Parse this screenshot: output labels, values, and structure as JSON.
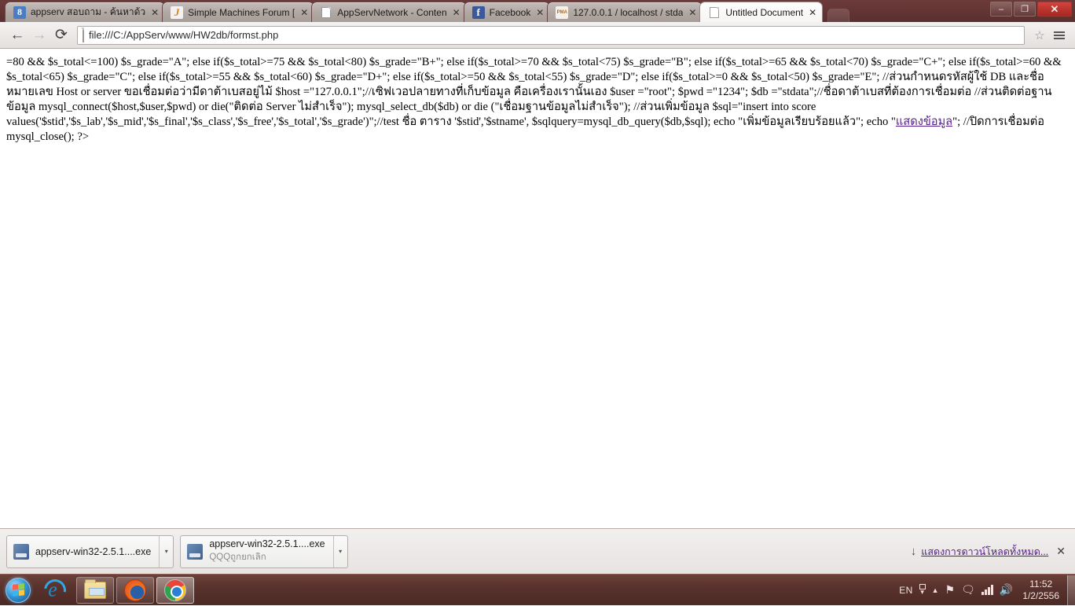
{
  "window": {
    "controls": {
      "minimize": "–",
      "maximize": "❐",
      "close": "✕"
    }
  },
  "tabs": [
    {
      "title": "appserv สอบถาม - ค้นหาด้ว",
      "favicon": "search-engine-icon",
      "favicon_text": "8",
      "active": false,
      "close": "✕"
    },
    {
      "title": "Simple Machines Forum [",
      "favicon": "forum-icon",
      "favicon_text": "J",
      "active": false,
      "close": "✕"
    },
    {
      "title": "AppServNetwork - Conten",
      "favicon": "page-icon",
      "favicon_text": "",
      "active": false,
      "close": "✕"
    },
    {
      "title": "Facebook",
      "favicon": "facebook-icon",
      "favicon_text": "f",
      "active": false,
      "close": "✕"
    },
    {
      "title": "127.0.0.1 / localhost / stda",
      "favicon": "phpmyadmin-icon",
      "favicon_text": "PMA",
      "active": false,
      "close": "✕"
    },
    {
      "title": "Untitled Document",
      "favicon": "page-icon",
      "favicon_text": "",
      "active": true,
      "close": "✕"
    }
  ],
  "toolbar": {
    "back": "←",
    "forward": "→",
    "reload": "⟳",
    "url": "file:///C:/AppServ/www/HW2db/formst.php",
    "star": "☆",
    "menu": "menu-icon"
  },
  "page": {
    "title": "Untitled Document",
    "body_html": "=80 &amp;&amp; $s_total&lt;=100) $s_grade=\"A\"; else if($s_total&gt;=75 &amp;&amp; $s_total&lt;80) $s_grade=\"B+\"; else if($s_total&gt;=70 &amp;&amp; $s_total&lt;75) $s_grade=\"B\"; else if($s_total&gt;=65 &amp;&amp; $s_total&lt;70) $s_grade=\"C+\"; else if($s_total&gt;=60 &amp;&amp; $s_total&lt;65) $s_grade=\"C\"; else if($s_total&gt;=55 &amp;&amp; $s_total&lt;60) $s_grade=\"D+\"; else if($s_total&gt;=50 &amp;&amp; $s_total&lt;55) $s_grade=\"D\"; else if($s_total&gt;=0 &amp;&amp; $s_total&lt;50) $s_grade=\"E\"; //ส่วนกำหนดรหัสผู้ใช้ DB และชื่อหมายเลข Host or server ขอเชื่อมต่อว่ามีดาต้าเบสอยู่ไม้ $host =\"127.0.0.1\";//เซิฟเวอปลายทางที่เก็บข้อมูล คือเครื่องเรานั้นเอง $user =\"root\"; $pwd =\"1234\"; $db =\"stdata\";//ชื่อดาต้าเบสที่ต้องการเชื่อมต่อ //ส่วนติดต่อฐานข้อมูล mysql_connect($host,$user,$pwd) or die(\"ติดต่อ Server ไม่สำเร็จ\"); mysql_select_db($db) or die (\"เชื่อมฐานข้อมูลไม่สำเร็จ\"); //ส่วนเพิ่มข้อมูล $sql=\"insert into score values('$stid','$s_lab','$s_mid','$s_final','$s_class','$s_free','$s_total','$s_grade')\";//test ชื่อ ตาราง '$stid','$stname', $sqlquery=mysql_db_query($db,$sql); echo \"เพิ่มข้อมูลเรียบร้อยแล้ว\"; echo \"<a href=\"#\" data-name=\"show-data-link\" data-interactable=\"true\">แสดงข้อมูล</a>\"; //ปิดการเชื่อมต่อ mysql_close(); ?&gt;"
  },
  "download_shelf": {
    "items": [
      {
        "name": "appserv-win32-2.5.1....exe",
        "status": "",
        "caret": "▾"
      },
      {
        "name": "appserv-win32-2.5.1....exe",
        "status": "QQQถูกยกเลิก",
        "caret": "▾"
      }
    ],
    "show_all_label": "แสดงการดาวน์โหลดทั้งหมด...",
    "show_all_arrow": "↓",
    "close": "✕"
  },
  "taskbar": {
    "start": "start-orb",
    "buttons": [
      {
        "icon": "internet-explorer-icon",
        "state": "inactive"
      },
      {
        "icon": "windows-explorer-icon",
        "state": "pinned-active"
      },
      {
        "icon": "firefox-icon",
        "state": "pinned-active"
      },
      {
        "icon": "chrome-icon",
        "state": "chrome-active"
      }
    ],
    "tray": {
      "language": "EN",
      "time": "11:52",
      "date": "1/2/2556"
    }
  }
}
